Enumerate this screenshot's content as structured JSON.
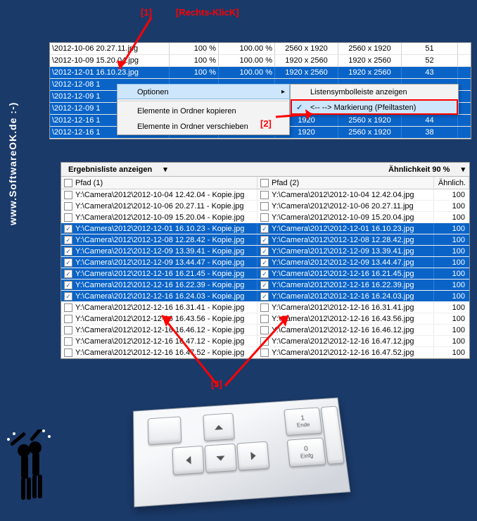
{
  "sidebar_brand": "www.SoftwareOK.de  :-)",
  "annotations": {
    "one": "[1]",
    "one_label": "[Rechts-KlicK]",
    "two": "[2]",
    "three": "[3]"
  },
  "top_table": {
    "rows": [
      {
        "sel": false,
        "name": "\\2012-10-06 20.27.11.jpg",
        "pct": "100 %",
        "pct2": "100.00 %",
        "dim": "2560 x 1920",
        "dim2": "2560 x 1920",
        "n": "51"
      },
      {
        "sel": false,
        "name": "\\2012-10-09 15.20.04.jpg",
        "pct": "100 %",
        "pct2": "100.00 %",
        "dim": "1920 x 2560",
        "dim2": "1920 x 2560",
        "n": "52"
      },
      {
        "sel": true,
        "name": "\\2012-12-01 16.10.23.jpg",
        "pct": "100 %",
        "pct2": "100.00 %",
        "dim": "1920 x 2560",
        "dim2": "1920 x 2560",
        "n": "43"
      },
      {
        "sel": true,
        "name": "\\2012-12-08 1",
        "pct": "",
        "pct2": "",
        "dim": "",
        "dim2": "",
        "n": ""
      },
      {
        "sel": true,
        "name": "\\2012-12-09 1",
        "pct": "",
        "pct2": "",
        "dim": "",
        "dim2": "",
        "n": ""
      },
      {
        "sel": true,
        "name": "\\2012-12-09 1",
        "pct": "",
        "pct2": "",
        "dim": "",
        "dim2": "",
        "n": ""
      },
      {
        "sel": true,
        "name": "\\2012-12-16 1",
        "pct": "",
        "pct2": "",
        "dim": "1920",
        "dim2": "2560 x 1920",
        "n": "44"
      },
      {
        "sel": true,
        "name": "\\2012-12-16 1",
        "pct": "",
        "pct2": "",
        "dim": "1920",
        "dim2": "2560 x 1920",
        "n": "38"
      }
    ]
  },
  "context_menu": {
    "options": "Optionen",
    "copy": "Elemente in Ordner kopieren",
    "move": "Elemente in Ordner verschieben",
    "sub_show_toolbar": "Listensymbolleiste anzeigen",
    "sub_arrow_mark": "<-- --> Markierung (Pfeiltasten)"
  },
  "result": {
    "header_left": "Ergebnisliste anzeigen",
    "header_right": "Ähnlichkeit 90 %",
    "col1": "Pfad (1)",
    "col2": "Pfad (2)",
    "col3": "Ähnlich.",
    "rows": [
      {
        "sel": false,
        "chk": false,
        "p1": "Y:\\Camera\\2012\\2012-10-04 12.42.04 - Kopie.jpg",
        "p2": "Y:\\Camera\\2012\\2012-10-04 12.42.04.jpg",
        "v": "100"
      },
      {
        "sel": false,
        "chk": false,
        "p1": "Y:\\Camera\\2012\\2012-10-06 20.27.11 - Kopie.jpg",
        "p2": "Y:\\Camera\\2012\\2012-10-06 20.27.11.jpg",
        "v": "100"
      },
      {
        "sel": false,
        "chk": false,
        "p1": "Y:\\Camera\\2012\\2012-10-09 15.20.04 - Kopie.jpg",
        "p2": "Y:\\Camera\\2012\\2012-10-09 15.20.04.jpg",
        "v": "100"
      },
      {
        "sel": true,
        "chk": true,
        "p1": "Y:\\Camera\\2012\\2012-12-01 16.10.23 - Kopie.jpg",
        "p2": "Y:\\Camera\\2012\\2012-12-01 16.10.23.jpg",
        "v": "100"
      },
      {
        "sel": true,
        "chk": true,
        "p1": "Y:\\Camera\\2012\\2012-12-08 12.28.42 - Kopie.jpg",
        "p2": "Y:\\Camera\\2012\\2012-12-08 12.28.42.jpg",
        "v": "100"
      },
      {
        "sel": true,
        "chk": true,
        "p1": "Y:\\Camera\\2012\\2012-12-09 13.39.41 - Kopie.jpg",
        "p2": "Y:\\Camera\\2012\\2012-12-09 13.39.41.jpg",
        "v": "100"
      },
      {
        "sel": true,
        "chk": true,
        "p1": "Y:\\Camera\\2012\\2012-12-09 13.44.47 - Kopie.jpg",
        "p2": "Y:\\Camera\\2012\\2012-12-09 13.44.47.jpg",
        "v": "100"
      },
      {
        "sel": true,
        "chk": true,
        "p1": "Y:\\Camera\\2012\\2012-12-16 16.21.45 - Kopie.jpg",
        "p2": "Y:\\Camera\\2012\\2012-12-16 16.21.45.jpg",
        "v": "100"
      },
      {
        "sel": true,
        "chk": true,
        "p1": "Y:\\Camera\\2012\\2012-12-16 16.22.39 - Kopie.jpg",
        "p2": "Y:\\Camera\\2012\\2012-12-16 16.22.39.jpg",
        "v": "100"
      },
      {
        "sel": true,
        "chk": true,
        "p1": "Y:\\Camera\\2012\\2012-12-16 16.24.03 - Kopie.jpg",
        "p2": "Y:\\Camera\\2012\\2012-12-16 16.24.03.jpg",
        "v": "100"
      },
      {
        "sel": false,
        "chk": false,
        "p1": "Y:\\Camera\\2012\\2012-12-16 16.31.41 - Kopie.jpg",
        "p2": "Y:\\Camera\\2012\\2012-12-16 16.31.41.jpg",
        "v": "100"
      },
      {
        "sel": false,
        "chk": false,
        "p1": "Y:\\Camera\\2012\\2012-12-16 16.43.56 - Kopie.jpg",
        "p2": "Y:\\Camera\\2012\\2012-12-16 16.43.56.jpg",
        "v": "100"
      },
      {
        "sel": false,
        "chk": false,
        "p1": "Y:\\Camera\\2012\\2012-12-16 16.46.12 - Kopie.jpg",
        "p2": "Y:\\Camera\\2012\\2012-12-16 16.46.12.jpg",
        "v": "100"
      },
      {
        "sel": false,
        "chk": false,
        "p1": "Y:\\Camera\\2012\\2012-12-16 16.47.12 - Kopie.jpg",
        "p2": "Y:\\Camera\\2012\\2012-12-16 16.47.12.jpg",
        "v": "100"
      },
      {
        "sel": false,
        "chk": false,
        "p1": "Y:\\Camera\\2012\\2012-12-16 16.47.52 - Kopie.jpg",
        "p2": "Y:\\Camera\\2012\\2012-12-16 16.47.52.jpg",
        "v": "100"
      }
    ]
  },
  "keyboard": {
    "end": "Ende",
    "ins": "Einfg",
    "num1": "1"
  }
}
